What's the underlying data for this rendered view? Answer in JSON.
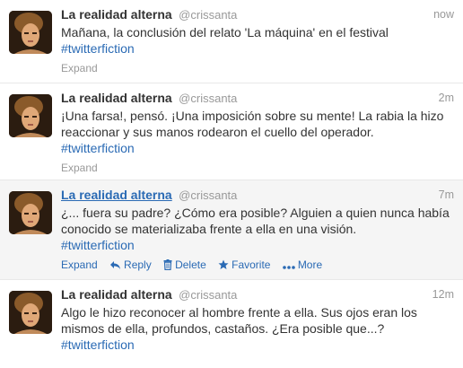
{
  "tweets": [
    {
      "fullname": "La realidad alterna",
      "username": "@crissanta",
      "time": "now",
      "text": "Mañana, la conclusión del relato 'La máquina' en el festival",
      "hashtag": "#twitterfiction",
      "expand": "Expand"
    },
    {
      "fullname": "La realidad alterna",
      "username": "@crissanta",
      "time": "2m",
      "text": "¡Una farsa!, pensó. ¡Una imposición sobre su mente! La rabia la hizo reaccionar y sus manos rodearon el cuello del operador.",
      "hashtag": "#twitterfiction",
      "expand": "Expand"
    },
    {
      "fullname": "La realidad alterna",
      "username": "@crissanta",
      "time": "7m",
      "text": "¿... fuera su padre? ¿Cómo era posible? Alguien a quien nunca había conocido se materializaba frente a ella en una visión.",
      "hashtag": "#twitterfiction",
      "expand": "Expand",
      "reply": "Reply",
      "delete": "Delete",
      "favorite": "Favorite",
      "more": "More"
    },
    {
      "fullname": "La realidad alterna",
      "username": "@crissanta",
      "time": "12m",
      "text": "Algo le hizo reconocer al hombre frente a ella. Sus ojos eran los mismos de ella, profundos, castaños. ¿Era posible que...?",
      "hashtag": "#twitterfiction"
    }
  ],
  "colors": {
    "link": "#2a6ab4",
    "muted": "#999999",
    "hover_bg": "#f5f5f5",
    "divider": "#e8e8e8"
  }
}
